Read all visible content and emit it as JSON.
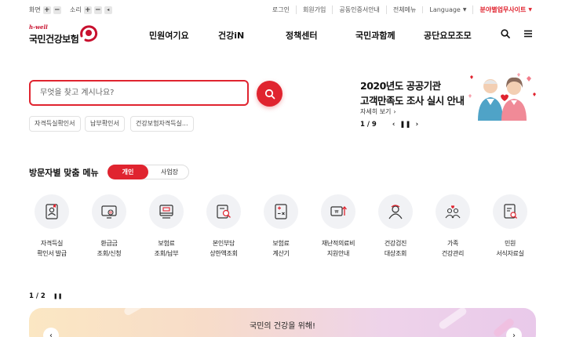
{
  "util": {
    "zoom_label": "화면",
    "sound_label": "소리",
    "links": [
      "로그인",
      "회원가입",
      "공동인증서안내",
      "전체메뉴"
    ],
    "language": "Language",
    "affiliated": "분야별업무사이트"
  },
  "logo": {
    "hwell": "h-well",
    "name": "국민건강보험"
  },
  "nav": [
    "민원여기요",
    "건강iN",
    "정책센터",
    "국민과함께",
    "공단요모조모"
  ],
  "search": {
    "placeholder": "무엇을 찾고 계시나요?"
  },
  "chips": [
    "자격득실확인서",
    "납부확인서",
    "건강보험자격득실..."
  ],
  "banner": {
    "line1": "2020년도 공공기관",
    "line2": "고객만족도 조사 실시 안내",
    "more": "자세히 보기",
    "page": "1 / 9"
  },
  "visitor": {
    "title": "방문자별 맞춤 메뉴",
    "tabs": [
      "개인",
      "사업장"
    ]
  },
  "services": [
    {
      "icon": "certificate-icon",
      "l1": "자격득실",
      "l2": "확인서 발급"
    },
    {
      "icon": "refund-icon",
      "l1": "환급금",
      "l2": "조회/신청"
    },
    {
      "icon": "premium-icon",
      "l1": "보험료",
      "l2": "조회/납부"
    },
    {
      "icon": "limit-icon",
      "l1": "본인부담",
      "l2": "상한액조회"
    },
    {
      "icon": "calculator-icon",
      "l1": "보험료",
      "l2": "계산기"
    },
    {
      "icon": "support-icon",
      "l1": "재난적의료비",
      "l2": "지원안내"
    },
    {
      "icon": "checkup-icon",
      "l1": "건강검진",
      "l2": "대상조회"
    },
    {
      "icon": "family-icon",
      "l1": "가족",
      "l2": "건강관리"
    },
    {
      "icon": "document-icon",
      "l1": "민원",
      "l2": "서식자료실"
    }
  ],
  "services_page": "1 / 2",
  "bottom_banner": {
    "text": "국민의 건강을 위해!"
  },
  "colors": {
    "accent": "#e0242f"
  }
}
